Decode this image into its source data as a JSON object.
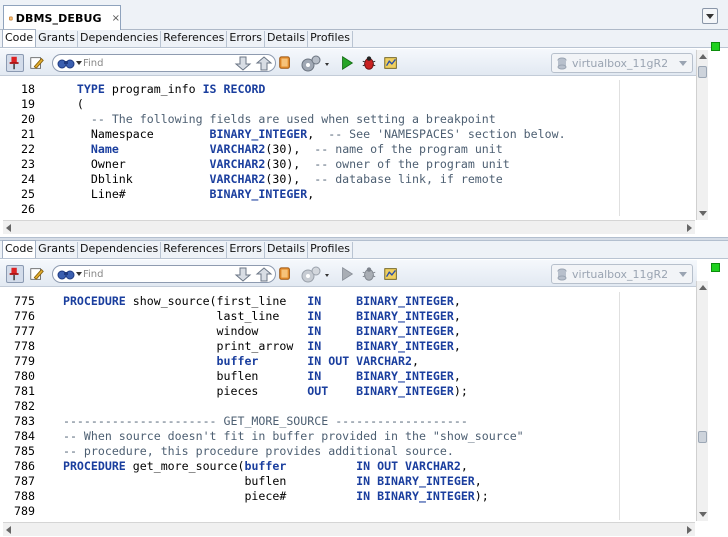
{
  "editor_tab": {
    "title": "DBMS_DEBUG",
    "close": "×"
  },
  "subtabs": [
    "Code",
    "Grants",
    "Dependencies",
    "References",
    "Errors",
    "Details",
    "Profiles"
  ],
  "toolbar": {
    "find_placeholder": "Find",
    "connection": "virtualbox_11gR2"
  },
  "pane1": {
    "lines": [
      {
        "n": "18",
        "segs": [
          [
            "",
            "    "
          ],
          [
            "kw",
            "TYPE"
          ],
          [
            "",
            " program_info "
          ],
          [
            "kw",
            "IS RECORD"
          ]
        ]
      },
      {
        "n": "19",
        "segs": [
          [
            "",
            "    ("
          ]
        ]
      },
      {
        "n": "20",
        "segs": [
          [
            "",
            "      "
          ],
          [
            "cm",
            "-- The following fields are used when setting a breakpoint"
          ]
        ]
      },
      {
        "n": "21",
        "segs": [
          [
            "",
            "      Namespace        "
          ],
          [
            "kw",
            "BINARY_INTEGER"
          ],
          [
            "",
            ",  "
          ],
          [
            "cm",
            "-- See 'NAMESPACES' section below."
          ]
        ]
      },
      {
        "n": "22",
        "segs": [
          [
            "",
            "      "
          ],
          [
            "kw",
            "Name"
          ],
          [
            "",
            "             "
          ],
          [
            "kw",
            "VARCHAR2"
          ],
          [
            "",
            "(30),  "
          ],
          [
            "cm",
            "-- name of the program unit"
          ]
        ]
      },
      {
        "n": "23",
        "segs": [
          [
            "",
            "      Owner            "
          ],
          [
            "kw",
            "VARCHAR2"
          ],
          [
            "",
            "(30),  "
          ],
          [
            "cm",
            "-- owner of the program unit"
          ]
        ]
      },
      {
        "n": "24",
        "segs": [
          [
            "",
            "      Dblink           "
          ],
          [
            "kw",
            "VARCHAR2"
          ],
          [
            "",
            "(30),  "
          ],
          [
            "cm",
            "-- database link, if remote"
          ]
        ]
      },
      {
        "n": "25",
        "segs": [
          [
            "",
            "      Line#            "
          ],
          [
            "kw",
            "BINARY_INTEGER"
          ],
          [
            "",
            ","
          ]
        ]
      },
      {
        "n": "26",
        "segs": [
          [
            "",
            ""
          ]
        ]
      }
    ]
  },
  "pane2": {
    "lines": [
      {
        "n": "775",
        "segs": [
          [
            "",
            "  "
          ],
          [
            "kw",
            "PROCEDURE"
          ],
          [
            "",
            " show_source(first_line   "
          ],
          [
            "kw",
            "IN"
          ],
          [
            "",
            "     "
          ],
          [
            "kw",
            "BINARY_INTEGER"
          ],
          [
            "",
            ","
          ]
        ]
      },
      {
        "n": "776",
        "segs": [
          [
            "",
            "                        last_line    "
          ],
          [
            "kw",
            "IN"
          ],
          [
            "",
            "     "
          ],
          [
            "kw",
            "BINARY_INTEGER"
          ],
          [
            "",
            ","
          ]
        ]
      },
      {
        "n": "777",
        "segs": [
          [
            "",
            "                        window       "
          ],
          [
            "kw",
            "IN"
          ],
          [
            "",
            "     "
          ],
          [
            "kw",
            "BINARY_INTEGER"
          ],
          [
            "",
            ","
          ]
        ]
      },
      {
        "n": "778",
        "segs": [
          [
            "",
            "                        print_arrow  "
          ],
          [
            "kw",
            "IN"
          ],
          [
            "",
            "     "
          ],
          [
            "kw",
            "BINARY_INTEGER"
          ],
          [
            "",
            ","
          ]
        ]
      },
      {
        "n": "779",
        "segs": [
          [
            "",
            "                        "
          ],
          [
            "kw",
            "buffer"
          ],
          [
            "",
            "       "
          ],
          [
            "kw",
            "IN OUT VARCHAR2"
          ],
          [
            "",
            ","
          ]
        ]
      },
      {
        "n": "780",
        "segs": [
          [
            "",
            "                        buflen       "
          ],
          [
            "kw",
            "IN"
          ],
          [
            "",
            "     "
          ],
          [
            "kw",
            "BINARY_INTEGER"
          ],
          [
            "",
            ","
          ]
        ]
      },
      {
        "n": "781",
        "segs": [
          [
            "",
            "                        pieces       "
          ],
          [
            "kw",
            "OUT"
          ],
          [
            "",
            "    "
          ],
          [
            "kw",
            "BINARY_INTEGER"
          ],
          [
            "",
            ");"
          ]
        ]
      },
      {
        "n": "782",
        "segs": [
          [
            "",
            ""
          ]
        ]
      },
      {
        "n": "783",
        "segs": [
          [
            "",
            "  "
          ],
          [
            "cm",
            "---------------------- GET_MORE_SOURCE -------------------"
          ]
        ]
      },
      {
        "n": "784",
        "segs": [
          [
            "",
            "  "
          ],
          [
            "cm",
            "-- When source doesn't fit in buffer provided in the \"show_source\""
          ]
        ]
      },
      {
        "n": "785",
        "segs": [
          [
            "",
            "  "
          ],
          [
            "cm",
            "-- procedure, this procedure provides additional source."
          ]
        ]
      },
      {
        "n": "786",
        "segs": [
          [
            "",
            "  "
          ],
          [
            "kw",
            "PROCEDURE"
          ],
          [
            "",
            " get_more_source("
          ],
          [
            "kw",
            "buffer"
          ],
          [
            "",
            "          "
          ],
          [
            "kw",
            "IN OUT VARCHAR2"
          ],
          [
            "",
            ","
          ]
        ]
      },
      {
        "n": "787",
        "segs": [
          [
            "",
            "                            buflen          "
          ],
          [
            "kw",
            "IN BINARY_INTEGER"
          ],
          [
            "",
            ","
          ]
        ]
      },
      {
        "n": "788",
        "segs": [
          [
            "",
            "                            piece#          "
          ],
          [
            "kw",
            "IN BINARY_INTEGER"
          ],
          [
            "",
            ");"
          ]
        ]
      },
      {
        "n": "789",
        "segs": [
          [
            "",
            ""
          ]
        ]
      }
    ]
  },
  "colors": {
    "keyword": "#1a3e9e",
    "comment": "#4d5f72",
    "indicator": "#1fd11f"
  }
}
